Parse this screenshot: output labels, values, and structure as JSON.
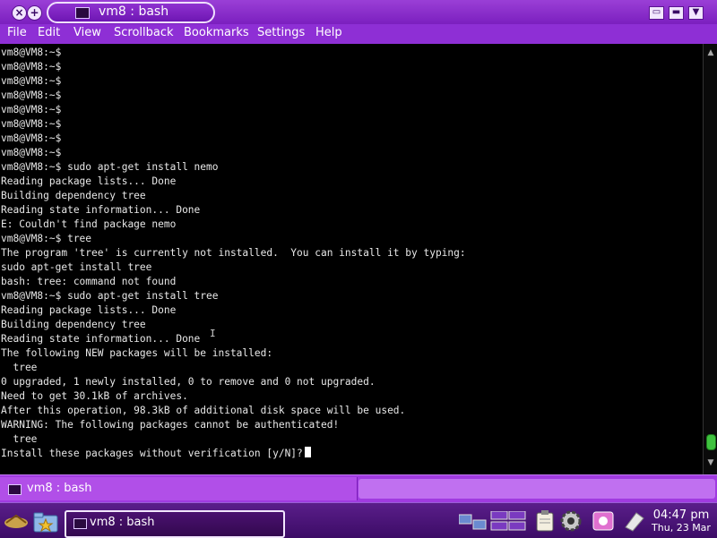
{
  "window": {
    "title": "vm8 : bash"
  },
  "menu": [
    "File",
    "Edit",
    "View",
    "Scrollback",
    "Bookmarks",
    "Settings",
    "Help"
  ],
  "terminal": {
    "lines": [
      "vm8@VM8:~$",
      "vm8@VM8:~$",
      "vm8@VM8:~$",
      "vm8@VM8:~$",
      "vm8@VM8:~$",
      "vm8@VM8:~$",
      "vm8@VM8:~$",
      "vm8@VM8:~$",
      "vm8@VM8:~$ sudo apt-get install nemo",
      "Reading package lists... Done",
      "Building dependency tree",
      "Reading state information... Done",
      "E: Couldn't find package nemo",
      "vm8@VM8:~$ tree",
      "The program 'tree' is currently not installed.  You can install it by typing:",
      "sudo apt-get install tree",
      "bash: tree: command not found",
      "vm8@VM8:~$ sudo apt-get install tree",
      "Reading package lists... Done",
      "Building dependency tree",
      "Reading state information... Done",
      "The following NEW packages will be installed:",
      "  tree",
      "0 upgraded, 1 newly installed, 0 to remove and 0 not upgraded.",
      "Need to get 30.1kB of archives.",
      "After this operation, 98.3kB of additional disk space will be used.",
      "WARNING: The following packages cannot be authenticated!",
      "  tree",
      "Install these packages without verification [y/N]?"
    ]
  },
  "tabs": {
    "session": "vm8 : bash"
  },
  "taskbar": {
    "task_label": "vm8 : bash",
    "time": "04:47 pm",
    "date": "Thu, 23 Mar"
  },
  "colors": {
    "accent": "#8e2fd5",
    "terminal_bg": "#000000",
    "terminal_fg": "#e8e8e8"
  },
  "icons": [
    "close-icon",
    "new-window-icon",
    "terminal-icon",
    "minimize-icon",
    "maximize-icon",
    "launcher-icon",
    "home-folder-icon",
    "star-icon",
    "desktop-switcher-icon",
    "clipboard-icon",
    "settings-icon",
    "media-icon",
    "eject-icon"
  ]
}
